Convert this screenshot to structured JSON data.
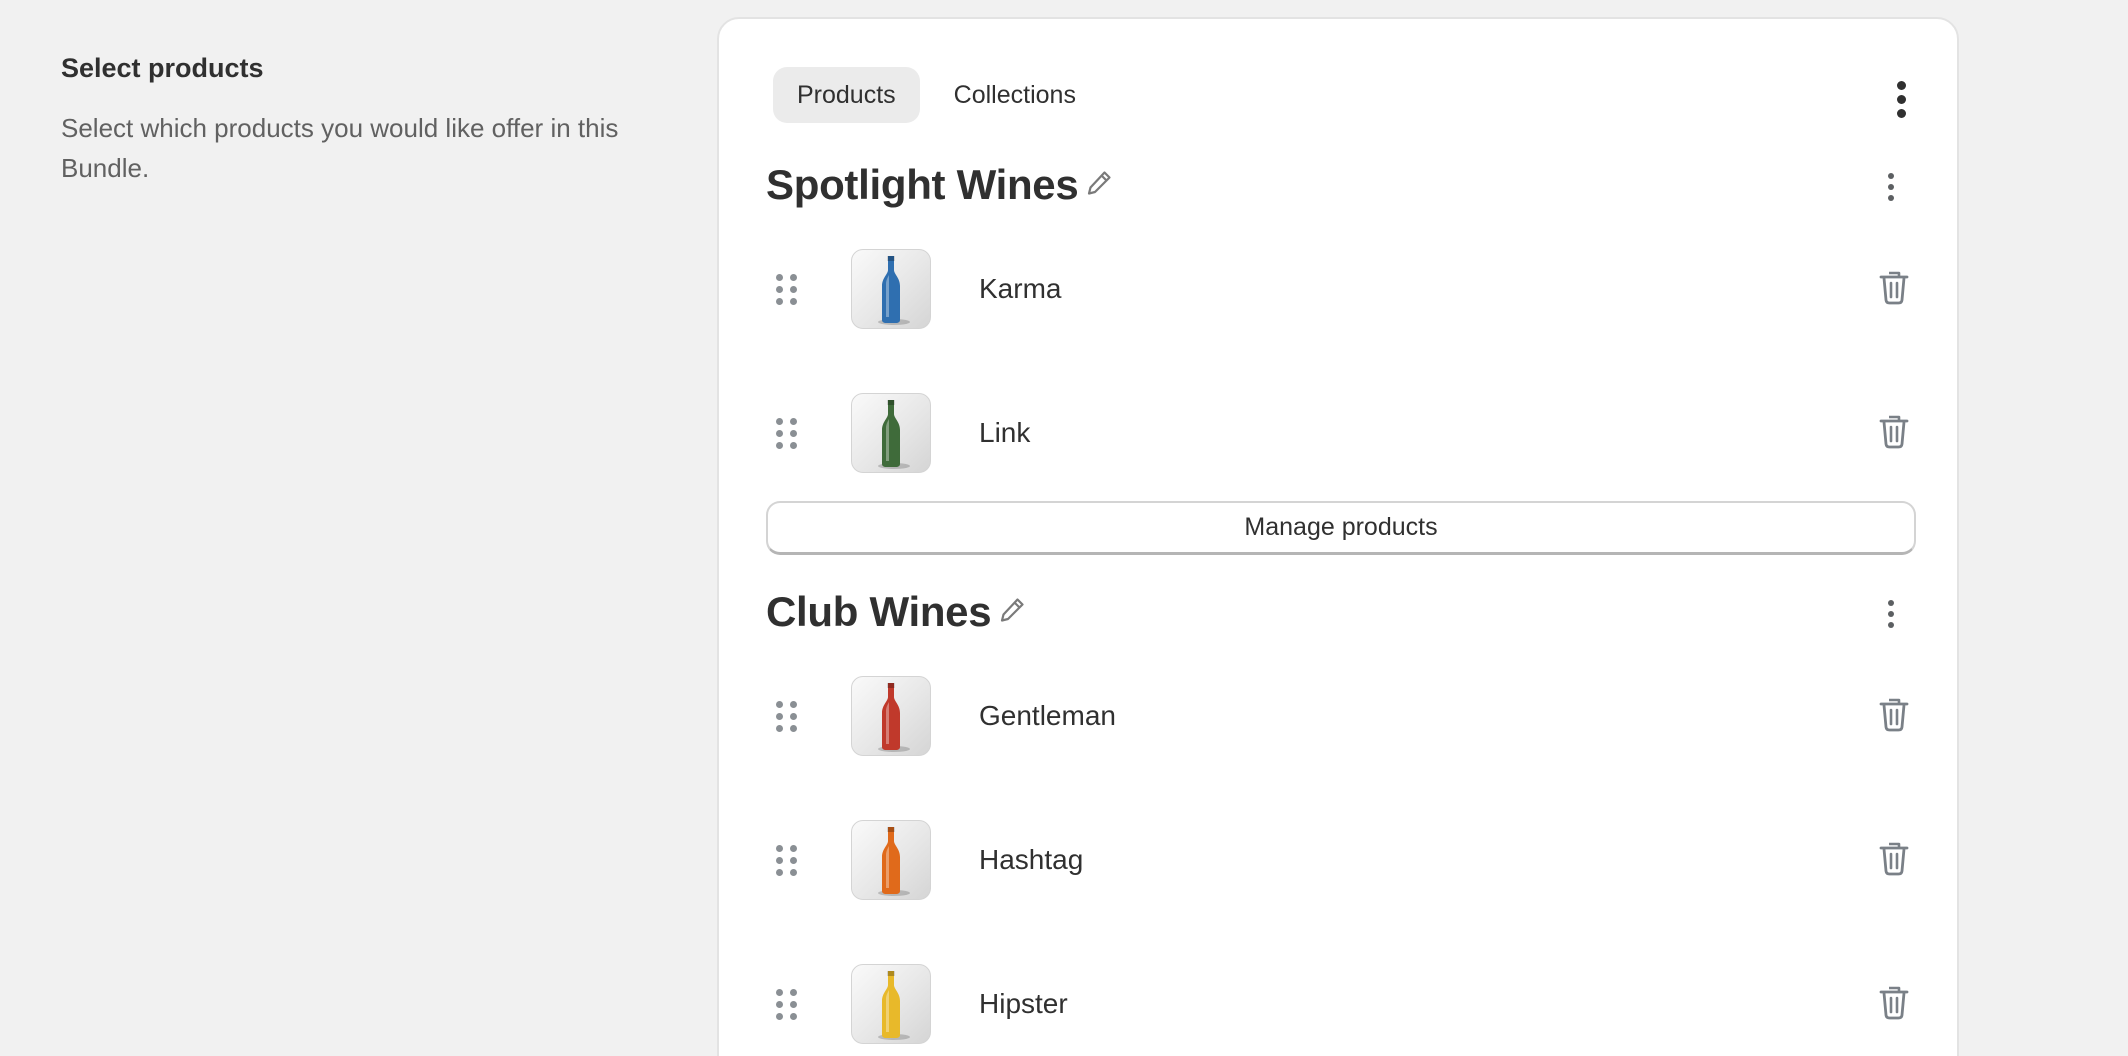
{
  "section": {
    "title": "Select products",
    "description": "Select which products you would like offer in this Bundle."
  },
  "tabs": [
    {
      "label": "Products",
      "active": true
    },
    {
      "label": "Collections",
      "active": false
    }
  ],
  "groups": [
    {
      "title": "Spotlight Wines",
      "items": [
        {
          "name": "Karma",
          "bottle_color": "#2f6fb0"
        },
        {
          "name": "Link",
          "bottle_color": "#3f6b3a"
        }
      ],
      "manage_label": "Manage products"
    },
    {
      "title": "Club Wines",
      "items": [
        {
          "name": "Gentleman",
          "bottle_color": "#c0392b"
        },
        {
          "name": "Hashtag",
          "bottle_color": "#e06a1b"
        },
        {
          "name": "Hipster",
          "bottle_color": "#e8b92a"
        }
      ]
    }
  ],
  "icons": {
    "card_menu": "vertical-ellipsis-icon",
    "group_menu": "vertical-ellipsis-icon",
    "edit": "pencil-icon",
    "drag": "drag-handle-icon",
    "delete": "trash-icon"
  }
}
